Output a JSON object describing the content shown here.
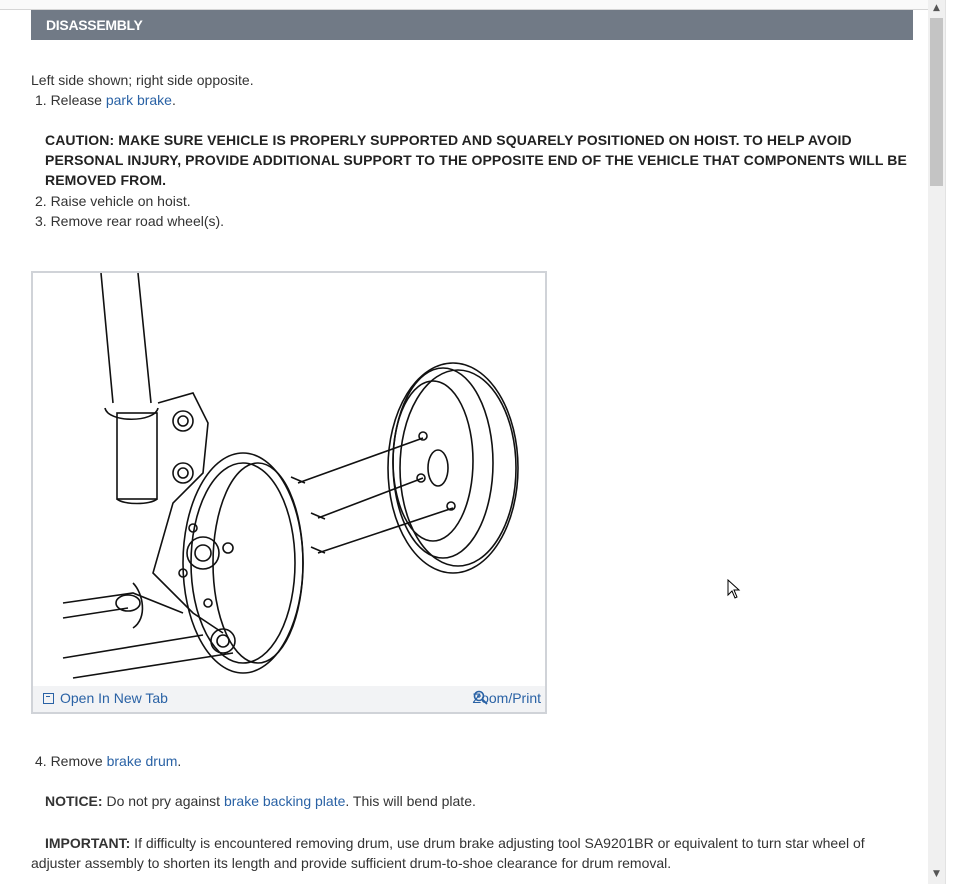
{
  "section": {
    "title": "DISASSEMBLY"
  },
  "intro": "Left side shown; right side opposite.",
  "steps": {
    "s1_prefix": "1. Release ",
    "s1_link": "park brake",
    "s1_suffix": ".",
    "s2": "2. Raise vehicle on hoist.",
    "s3": "3. Remove rear road wheel(s).",
    "s4_prefix": "4. Remove ",
    "s4_link": "brake drum",
    "s4_suffix": "."
  },
  "caution": {
    "text": "CAUTION: MAKE SURE VEHICLE IS PROPERLY SUPPORTED AND SQUARELY POSITIONED ON HOIST. TO HELP AVOID PERSONAL INJURY, PROVIDE ADDITIONAL SUPPORT TO THE OPPOSITE END OF THE VEHICLE THAT COMPONENTS WILL BE REMOVED FROM."
  },
  "figure": {
    "open_label": "Open In New Tab",
    "zoom_label": "Zoom/Print",
    "open_icon": "open-new-tab-icon",
    "zoom_icon": "magnifier-icon"
  },
  "notice": {
    "label": "NOTICE:",
    "text_prefix": " Do not pry against ",
    "link": "brake backing plate",
    "text_suffix": ". This will bend plate."
  },
  "important": {
    "label": "IMPORTANT:",
    "line1": " If difficulty is encountered removing drum, use drum brake adjusting tool SA9201BR or equivalent to turn star wheel of",
    "line2": "adjuster assembly to shorten its length and provide sufficient drum-to-shoe clearance for drum removal."
  },
  "colors": {
    "header_bg": "#717a86",
    "link": "#2a62a5"
  }
}
